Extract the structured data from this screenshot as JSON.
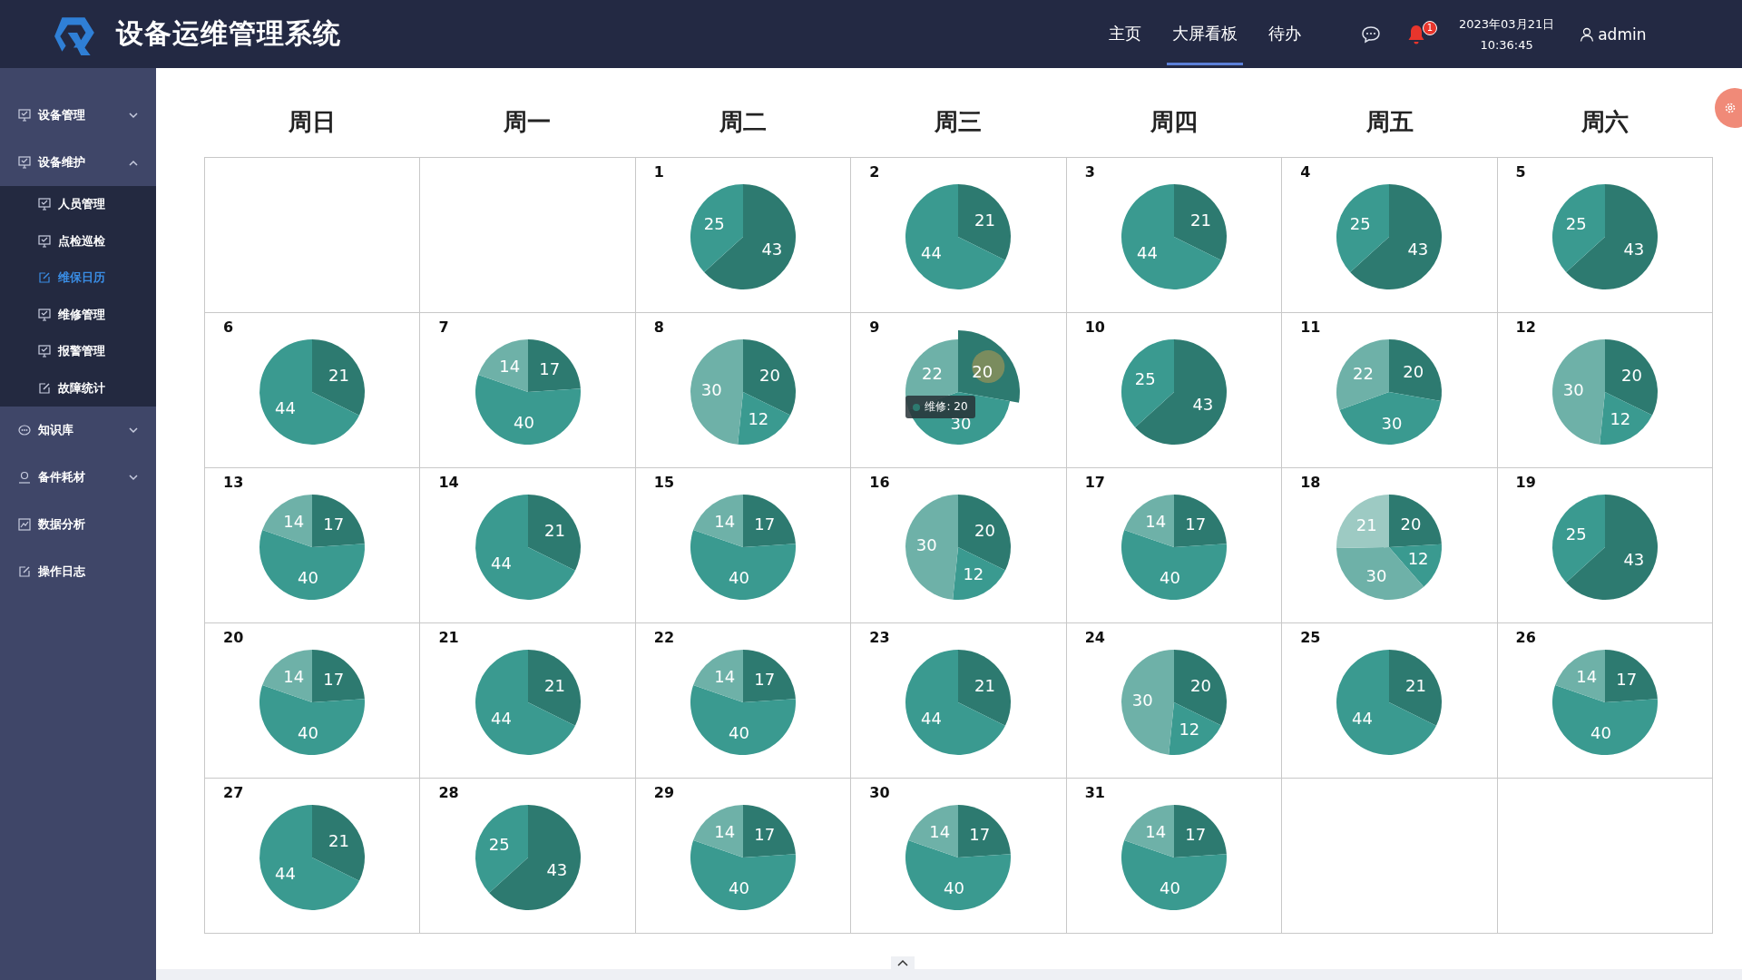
{
  "header": {
    "title": "设备运维管理系统",
    "nav": [
      {
        "label": "主页",
        "selected": false
      },
      {
        "label": "大屏看板",
        "selected": true
      },
      {
        "label": "待办",
        "selected": false
      }
    ],
    "notification_badge": "1",
    "date": "2023年03月21日",
    "time": "10:36:45",
    "user": "admin"
  },
  "sidebar": {
    "items": [
      {
        "label": "设备管理",
        "kind": "monitor",
        "expanded": false
      },
      {
        "label": "设备维护",
        "kind": "monitor",
        "expanded": true,
        "children": [
          {
            "label": "人员管理",
            "kind": "monitor",
            "selected": false
          },
          {
            "label": "点检巡检",
            "kind": "monitor",
            "selected": false
          },
          {
            "label": "维保日历",
            "kind": "edit",
            "selected": true
          },
          {
            "label": "维修管理",
            "kind": "monitor",
            "selected": false
          },
          {
            "label": "报警管理",
            "kind": "monitor",
            "selected": false
          },
          {
            "label": "故障统计",
            "kind": "edit",
            "selected": false
          }
        ]
      },
      {
        "label": "知识库",
        "kind": "chat",
        "expanded": false
      },
      {
        "label": "备件耗材",
        "kind": "user",
        "expanded": false
      },
      {
        "label": "数据分析",
        "kind": "chart"
      },
      {
        "label": "操作日志",
        "kind": "edit"
      }
    ]
  },
  "calendar": {
    "weekdays": [
      "周日",
      "周一",
      "周二",
      "周三",
      "周四",
      "周五",
      "周六"
    ],
    "cells": [
      {
        "kind": "empty"
      },
      {
        "kind": "empty"
      },
      {
        "kind": "day",
        "day": "1",
        "chart_data": {
          "type": "pie",
          "values": [
            43,
            25
          ],
          "data_labels": true
        }
      },
      {
        "kind": "day",
        "day": "2",
        "chart_data": {
          "type": "pie",
          "values": [
            21,
            44
          ],
          "data_labels": true
        }
      },
      {
        "kind": "day",
        "day": "3",
        "chart_data": {
          "type": "pie",
          "values": [
            21,
            44
          ],
          "data_labels": true
        }
      },
      {
        "kind": "day",
        "day": "4",
        "chart_data": {
          "type": "pie",
          "values": [
            43,
            25
          ],
          "data_labels": true
        }
      },
      {
        "kind": "day",
        "day": "5",
        "chart_data": {
          "type": "pie",
          "values": [
            43,
            25
          ],
          "data_labels": true
        }
      },
      {
        "kind": "day",
        "day": "6",
        "chart_data": {
          "type": "pie",
          "values": [
            21,
            44
          ],
          "data_labels": true
        }
      },
      {
        "kind": "day",
        "day": "7",
        "chart_data": {
          "type": "pie",
          "values": [
            17,
            40,
            14
          ],
          "data_labels": true
        }
      },
      {
        "kind": "day",
        "day": "8",
        "chart_data": {
          "type": "pie",
          "values": [
            20,
            12,
            30
          ],
          "data_labels": true
        }
      },
      {
        "kind": "day",
        "day": "9",
        "chart_data": {
          "type": "pie",
          "values": [
            20,
            30,
            22
          ],
          "data_labels": true,
          "annotations": [
            {
              "text": "维修: 20"
            }
          ]
        }
      },
      {
        "kind": "day",
        "day": "10",
        "chart_data": {
          "type": "pie",
          "values": [
            43,
            25
          ],
          "data_labels": true
        }
      },
      {
        "kind": "day",
        "day": "11",
        "chart_data": {
          "type": "pie",
          "values": [
            20,
            30,
            22
          ],
          "data_labels": true
        }
      },
      {
        "kind": "day",
        "day": "12",
        "chart_data": {
          "type": "pie",
          "values": [
            20,
            12,
            30
          ],
          "data_labels": true
        }
      },
      {
        "kind": "day",
        "day": "13",
        "chart_data": {
          "type": "pie",
          "values": [
            17,
            40,
            14
          ],
          "data_labels": true
        }
      },
      {
        "kind": "day",
        "day": "14",
        "chart_data": {
          "type": "pie",
          "values": [
            21,
            44
          ],
          "data_labels": true
        }
      },
      {
        "kind": "day",
        "day": "15",
        "chart_data": {
          "type": "pie",
          "values": [
            17,
            40,
            14
          ],
          "data_labels": true
        }
      },
      {
        "kind": "day",
        "day": "16",
        "chart_data": {
          "type": "pie",
          "values": [
            20,
            12,
            30
          ],
          "data_labels": true
        }
      },
      {
        "kind": "day",
        "day": "17",
        "chart_data": {
          "type": "pie",
          "values": [
            17,
            40,
            14
          ],
          "data_labels": true
        }
      },
      {
        "kind": "day",
        "day": "18",
        "chart_data": {
          "type": "pie",
          "values": [
            20,
            12,
            30,
            21
          ],
          "data_labels": true
        }
      },
      {
        "kind": "day",
        "day": "19",
        "chart_data": {
          "type": "pie",
          "values": [
            43,
            25
          ],
          "data_labels": true
        }
      },
      {
        "kind": "day",
        "day": "20",
        "chart_data": {
          "type": "pie",
          "values": [
            17,
            40,
            14
          ],
          "data_labels": true
        }
      },
      {
        "kind": "day",
        "day": "21",
        "chart_data": {
          "type": "pie",
          "values": [
            21,
            44
          ],
          "data_labels": true
        }
      },
      {
        "kind": "day",
        "day": "22",
        "chart_data": {
          "type": "pie",
          "values": [
            17,
            40,
            14
          ],
          "data_labels": true
        }
      },
      {
        "kind": "day",
        "day": "23",
        "chart_data": {
          "type": "pie",
          "values": [
            21,
            44
          ],
          "data_labels": true
        }
      },
      {
        "kind": "day",
        "day": "24",
        "chart_data": {
          "type": "pie",
          "values": [
            20,
            12,
            30
          ],
          "data_labels": true
        }
      },
      {
        "kind": "day",
        "day": "25",
        "chart_data": {
          "type": "pie",
          "values": [
            21,
            44
          ],
          "data_labels": true
        }
      },
      {
        "kind": "day",
        "day": "26",
        "chart_data": {
          "type": "pie",
          "values": [
            17,
            40,
            14
          ],
          "data_labels": true
        }
      },
      {
        "kind": "day",
        "day": "27",
        "chart_data": {
          "type": "pie",
          "values": [
            21,
            44
          ],
          "data_labels": true
        }
      },
      {
        "kind": "day",
        "day": "28",
        "chart_data": {
          "type": "pie",
          "values": [
            43,
            25
          ],
          "data_labels": true
        }
      },
      {
        "kind": "day",
        "day": "29",
        "chart_data": {
          "type": "pie",
          "values": [
            17,
            40,
            14
          ],
          "data_labels": true
        }
      },
      {
        "kind": "day",
        "day": "30",
        "chart_data": {
          "type": "pie",
          "values": [
            17,
            40,
            14
          ],
          "data_labels": true
        }
      },
      {
        "kind": "day",
        "day": "31",
        "chart_data": {
          "type": "pie",
          "values": [
            17,
            40,
            14
          ],
          "data_labels": true
        }
      },
      {
        "kind": "empty"
      },
      {
        "kind": "empty"
      }
    ]
  }
}
